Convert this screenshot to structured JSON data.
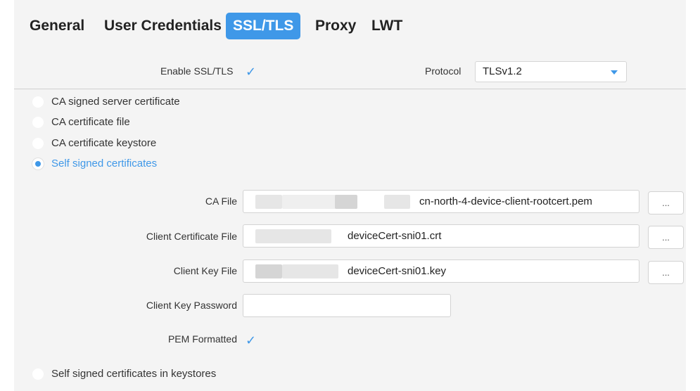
{
  "tabs": [
    {
      "label": "General"
    },
    {
      "label": "User Credentials"
    },
    {
      "label": "SSL/TLS",
      "active": true
    },
    {
      "label": "Proxy"
    },
    {
      "label": "LWT"
    }
  ],
  "ssl": {
    "enable_label": "Enable SSL/TLS",
    "enable_checked": true,
    "protocol_label": "Protocol",
    "protocol_value": "TLSv1.2"
  },
  "cert_options": [
    {
      "label": "CA signed server certificate",
      "selected": false
    },
    {
      "label": "CA certificate file",
      "selected": false
    },
    {
      "label": "CA certificate keystore",
      "selected": false
    },
    {
      "label": "Self signed certificates",
      "selected": true
    }
  ],
  "self_signed": {
    "ca_file_label": "CA File",
    "ca_file_value": "cn-north-4-device-client-rootcert.pem",
    "client_cert_label": "Client Certificate File",
    "client_cert_value": "deviceCert-sni01.crt",
    "client_key_label": "Client Key File",
    "client_key_value": "deviceCert-sni01.key",
    "client_key_password_label": "Client Key Password",
    "client_key_password_value": "",
    "pem_label": "PEM Formatted",
    "pem_checked": true,
    "browse_label": "..."
  },
  "keystore_option": {
    "label": "Self signed certificates in keystores",
    "selected": false
  },
  "colors": {
    "accent": "#3f98e8",
    "panel_bg": "#f4f4f4"
  }
}
